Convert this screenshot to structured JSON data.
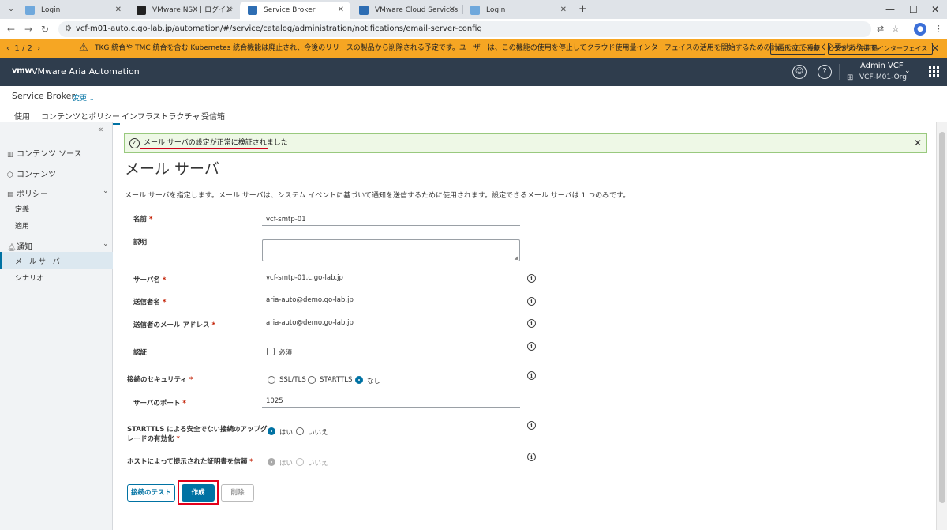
{
  "browser": {
    "tabs": [
      {
        "label": "Login",
        "favicon_color": "#6fa8dc"
      },
      {
        "label": "VMware NSX | ログイン",
        "favicon_color": "#222222"
      },
      {
        "label": "Service Broker",
        "favicon_color": "#2d6db3"
      },
      {
        "label": "VMware Cloud Services",
        "favicon_color": "#2d6db3"
      },
      {
        "label": "Login",
        "favicon_color": "#6fa8dc"
      }
    ],
    "url": "vcf-m01-auto.c.go-lab.jp/automation/#/service/catalog/administration/notifications/email-server-config"
  },
  "banner": {
    "pager": "1 / 2",
    "message": "TKG 統合や TMC 統合を含む Kubernetes 統合機能は廃止され、今後のリリースの製品から削除される予定です。ユーザーは、この機能の使用を停止してクラウド使用量インターフェイスの活用を開始するための計画を立てておく必要があります。",
    "button_deprecated": "廃止された機能",
    "button_cloud": "クラウド使用量インターフェイス"
  },
  "header": {
    "logo": "vmw",
    "title": "VMware Aria Automation",
    "user": "Admin VCF",
    "org": "VCF-M01-Org"
  },
  "subheader": {
    "service": "Service Broker",
    "change": "変更",
    "tabs": [
      "使用",
      "コンテンツとポリシー",
      "インフラストラクチャ",
      "受信箱"
    ]
  },
  "sidebar": {
    "content_source": "コンテンツ ソース",
    "content": "コンテンツ",
    "policy": "ポリシー",
    "policy_definition": "定義",
    "policy_apply": "適用",
    "notification": "通知",
    "mail_server": "メール サーバ",
    "scenario": "シナリオ"
  },
  "alert": {
    "message": "メール サーバの設定が正常に検証されました"
  },
  "page": {
    "title": "メール サーバ",
    "description": "メール サーバを指定します。メール サーバは、システム イベントに基づいて通知を送信するために使用されます。設定できるメール サーバは 1 つのみです。"
  },
  "form": {
    "name_label": "名前",
    "name_value": "vcf-smtp-01",
    "description_label": "説明",
    "server_label": "サーバ名",
    "server_value": "vcf-smtp-01.c.go-lab.jp",
    "sender_name_label": "送信者名",
    "sender_name_value": "aria-auto@demo.go-lab.jp",
    "sender_email_label": "送信者のメール アドレス",
    "sender_email_value": "aria-auto@demo.go-lab.jp",
    "auth_label": "認証",
    "auth_required": "必須",
    "security_label": "接続のセキュリティ",
    "security_options": [
      "SSL/TLS",
      "STARTTLS",
      "なし"
    ],
    "security_selected": "なし",
    "port_label": "サーバのポート",
    "port_value": "1025",
    "starttls_label_line1": "STARTTLS による安全でない接続のアップグ",
    "starttls_label_line2": "レードの有効化",
    "starttls_yes": "はい",
    "starttls_no": "いいえ",
    "trust_label": "ホストによって提示された証明書を信頼",
    "trust_yes": "はい",
    "trust_no": "いいえ"
  },
  "buttons": {
    "test": "接続のテスト",
    "create": "作成",
    "delete": "削除"
  }
}
